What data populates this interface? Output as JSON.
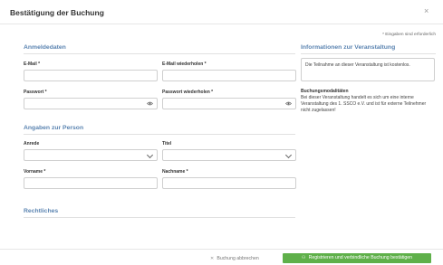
{
  "dialog": {
    "title": "Bestätigung der Buchung",
    "close_icon": "×",
    "required_note": "* Eingaben sind erforderlich"
  },
  "sections": {
    "anmeldedaten": "Anmeldedaten",
    "person": "Angaben zur Person",
    "rechtliches": "Rechtliches",
    "info": "Informationen zur Veranstaltung"
  },
  "fields": {
    "email": {
      "label": "E-Mail *",
      "value": ""
    },
    "email_repeat": {
      "label": "E-Mail wiederholen *",
      "value": ""
    },
    "password": {
      "label": "Passwort *",
      "value": ""
    },
    "password_repeat": {
      "label": "Passwort wiederholen *",
      "value": ""
    },
    "anrede": {
      "label": "Anrede",
      "value": ""
    },
    "titel": {
      "label": "Titel",
      "value": ""
    },
    "vorname": {
      "label": "Vorname *",
      "value": ""
    },
    "nachname": {
      "label": "Nachname *",
      "value": ""
    }
  },
  "icons": {
    "eye": "eye-icon",
    "chevron": "chevron-down-icon",
    "close": "close-icon",
    "user_plus": "user-plus-icon"
  },
  "info": {
    "box_text": "Die Teilnahme an dieser Veranstaltung ist kostenlos.",
    "modalities_title": "Buchungsmodalitäten",
    "modalities_text": "Bei dieser Veranstaltung handelt es sich um eine interne Veranstaltung des 1. SSCO e.V. und ist für externe Teilnehmer nicht zugelassen!"
  },
  "footer": {
    "cancel_label": "Buchung abbrechen",
    "confirm_label": "Registrieren und verbindliche Buchung bestätigen"
  },
  "colors": {
    "accent": "#5b84b1",
    "confirm": "#5fb04a"
  }
}
